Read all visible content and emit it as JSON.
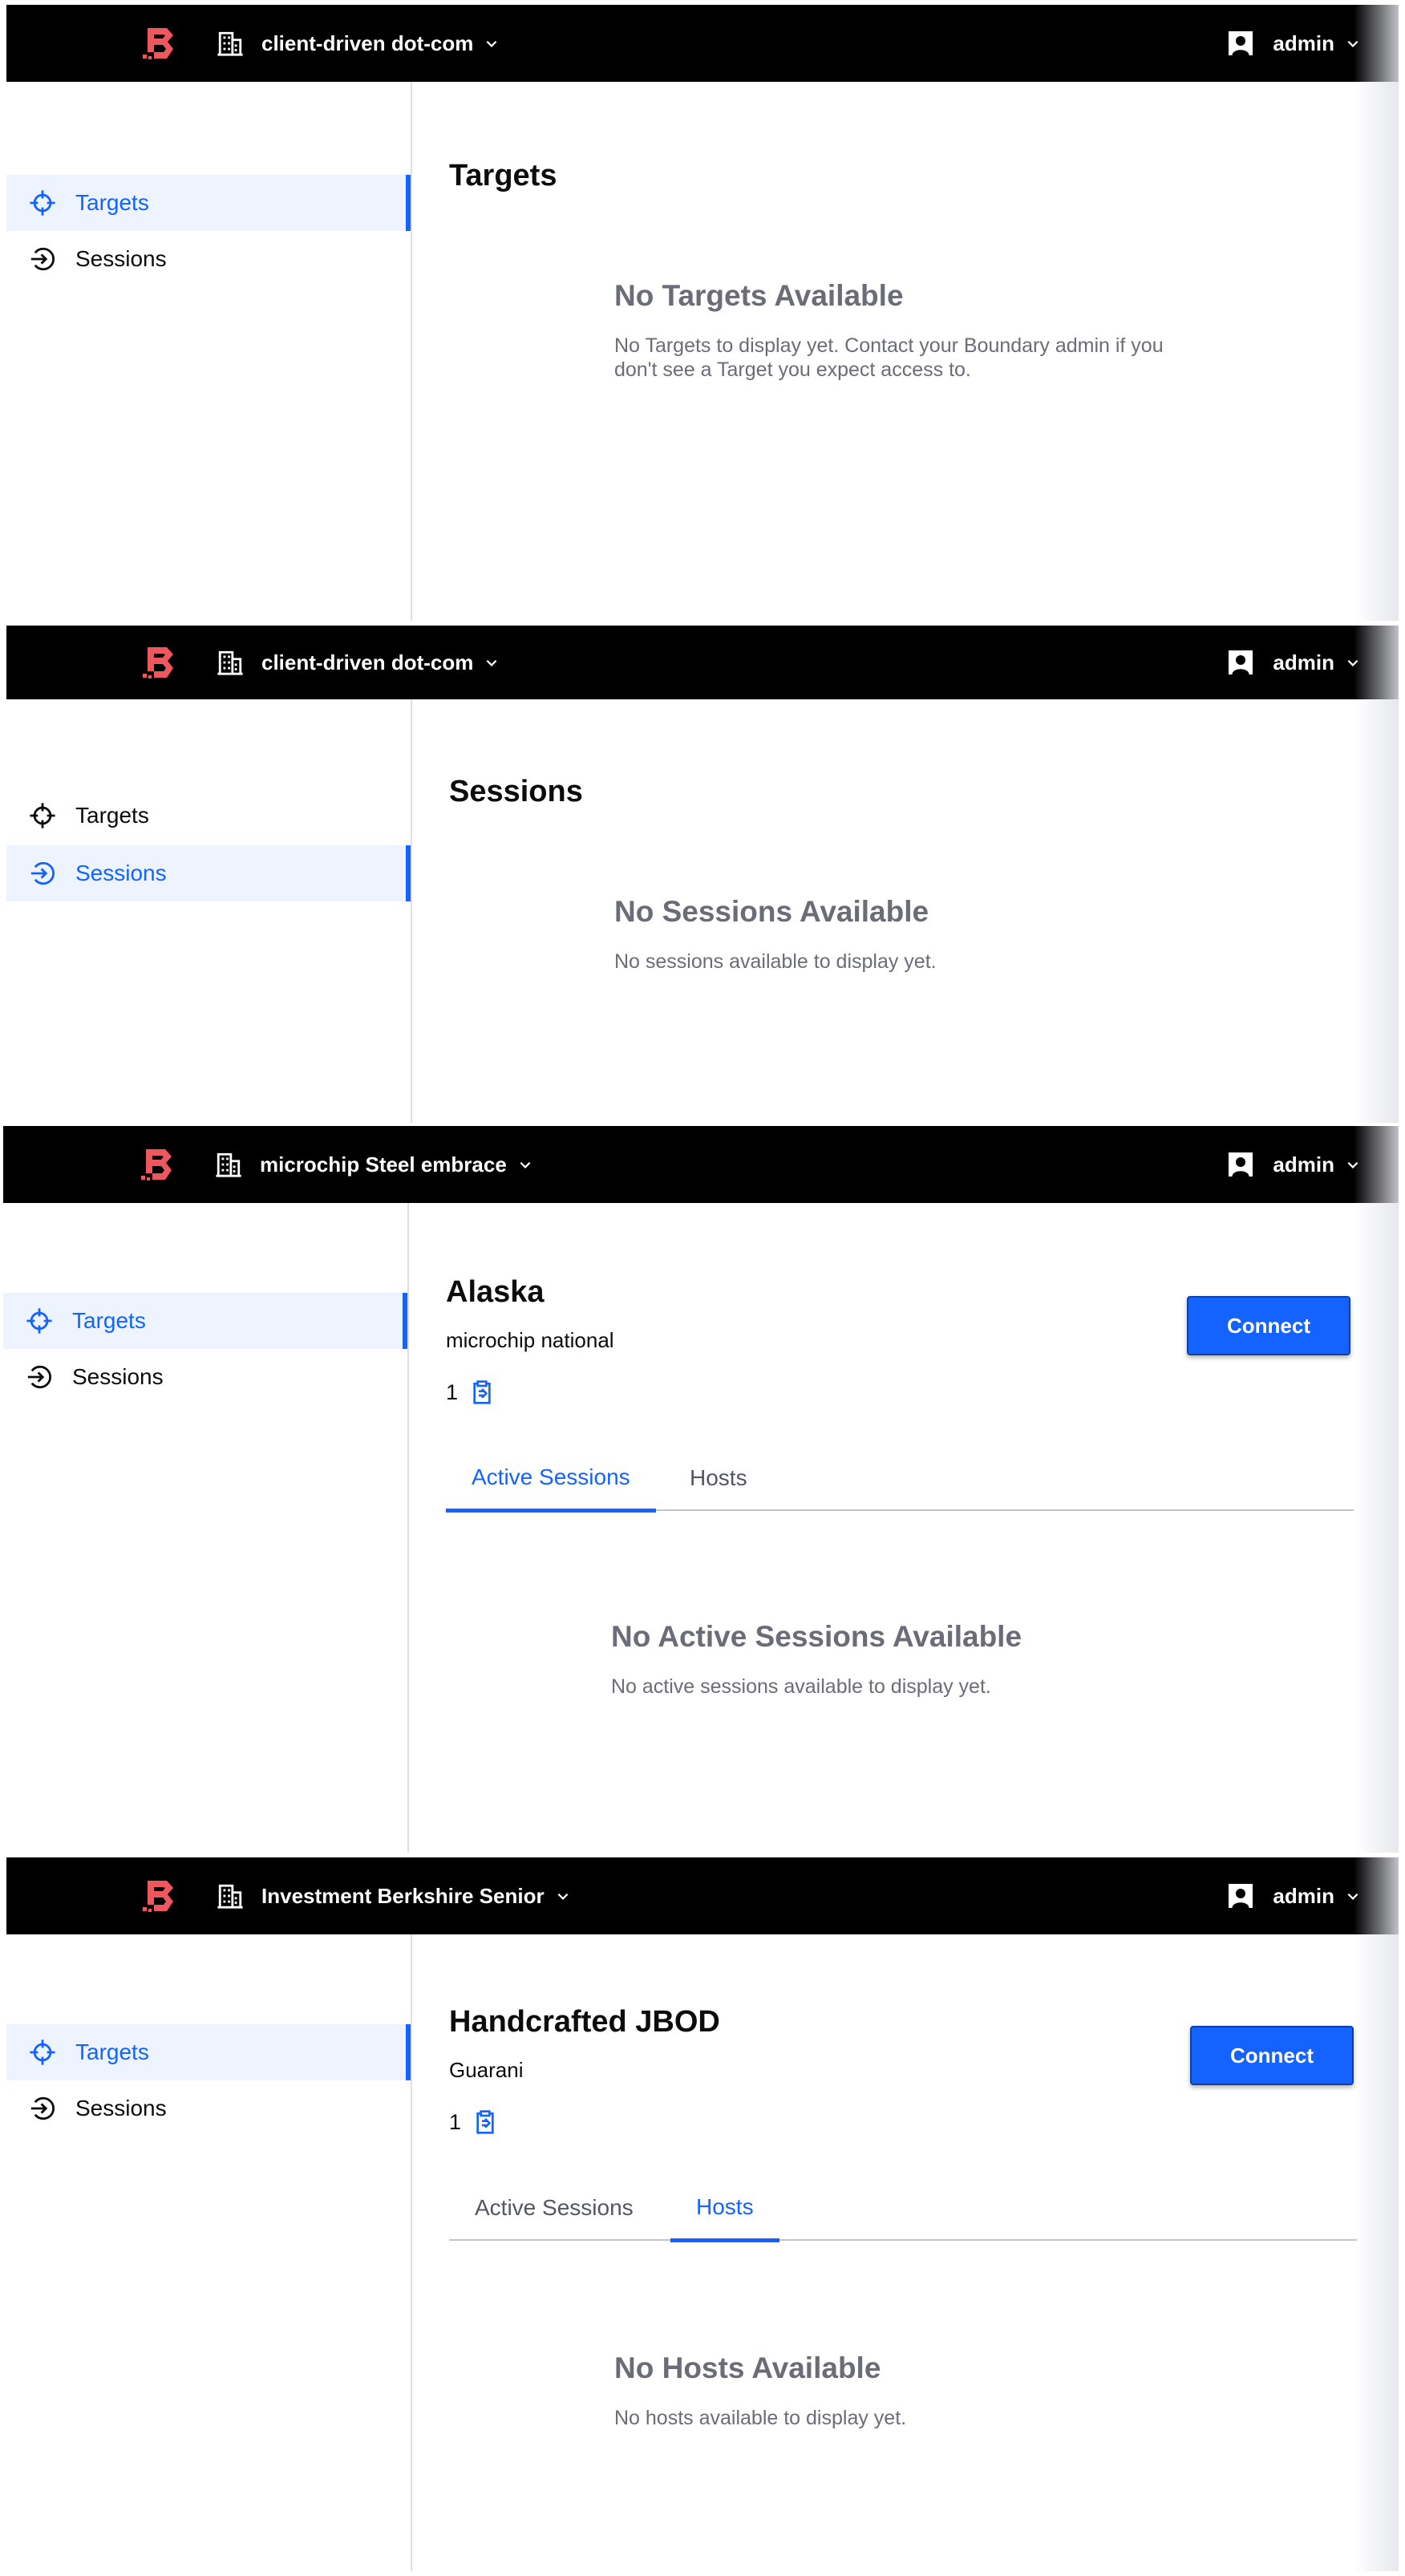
{
  "colors": {
    "header_bg": "#000000",
    "accent": "#1563ff",
    "active_nav_bg": "#eef4ff",
    "logo_red": "#ec585d",
    "muted_text": "#6a6d77"
  },
  "screens": [
    {
      "org_name": "client-driven dot-com",
      "user_name": "admin",
      "nav": [
        {
          "label": "Targets",
          "icon": "crosshair-icon",
          "active": true
        },
        {
          "label": "Sessions",
          "icon": "sign-in-arrow-icon",
          "active": false
        }
      ],
      "page_title": "Targets",
      "empty_title": "No Targets Available",
      "empty_message": "No Targets to display yet. Contact your Boundary admin if you don't see a Target you expect access to."
    },
    {
      "org_name": "client-driven dot-com",
      "user_name": "admin",
      "nav": [
        {
          "label": "Targets",
          "icon": "crosshair-icon",
          "active": false
        },
        {
          "label": "Sessions",
          "icon": "sign-in-arrow-icon",
          "active": true
        }
      ],
      "page_title": "Sessions",
      "empty_title": "No Sessions Available",
      "empty_message": "No sessions available to display yet."
    },
    {
      "org_name": "microchip Steel embrace",
      "user_name": "admin",
      "nav": [
        {
          "label": "Targets",
          "icon": "crosshair-icon",
          "active": true
        },
        {
          "label": "Sessions",
          "icon": "sign-in-arrow-icon",
          "active": false
        }
      ],
      "page_title": "Alaska",
      "subtitle": "microchip national",
      "port": "1",
      "connect_label": "Connect",
      "tabs": [
        {
          "label": "Active Sessions",
          "active": true
        },
        {
          "label": "Hosts",
          "active": false
        }
      ],
      "empty_title": "No Active Sessions Available",
      "empty_message": "No active sessions available to display yet."
    },
    {
      "org_name": "Investment Berkshire Senior",
      "user_name": "admin",
      "nav": [
        {
          "label": "Targets",
          "icon": "crosshair-icon",
          "active": true
        },
        {
          "label": "Sessions",
          "icon": "sign-in-arrow-icon",
          "active": false
        }
      ],
      "page_title": "Handcrafted JBOD",
      "subtitle": "Guarani",
      "port": "1",
      "connect_label": "Connect",
      "tabs": [
        {
          "label": "Active Sessions",
          "active": false
        },
        {
          "label": "Hosts",
          "active": true
        }
      ],
      "empty_title": "No Hosts Available",
      "empty_message": "No hosts available to display yet."
    }
  ]
}
